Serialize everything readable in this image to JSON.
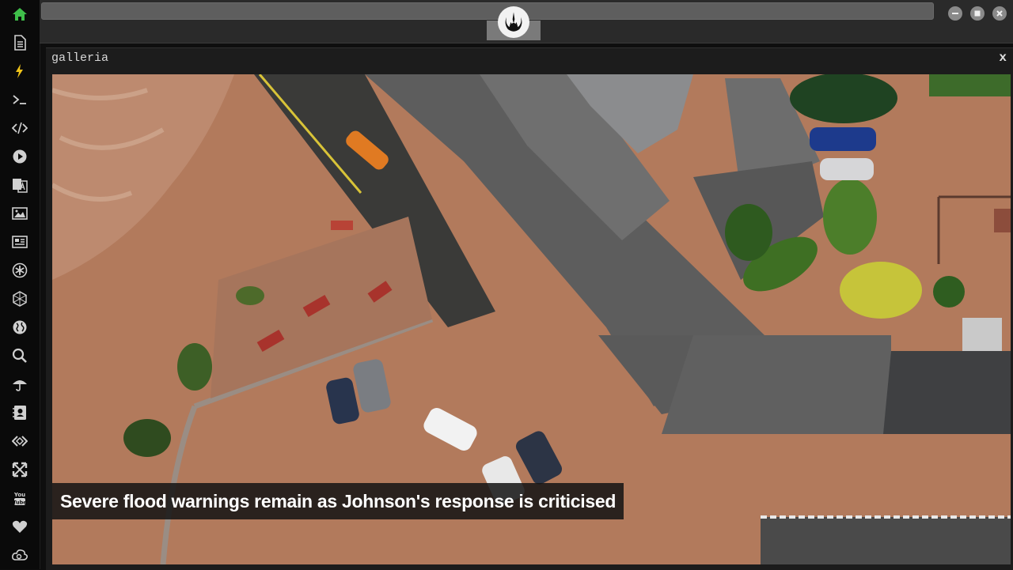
{
  "window": {
    "controls": {
      "minimize_icon": "minimize-icon",
      "maximize_icon": "maximize-icon",
      "close_icon": "close-icon"
    },
    "logo_icon": "rebel-alliance-icon"
  },
  "sidebar": {
    "items": [
      {
        "name": "home",
        "icon": "home-icon",
        "color": "#3fbf4a"
      },
      {
        "name": "document",
        "icon": "document-icon"
      },
      {
        "name": "lightning",
        "icon": "lightning-icon",
        "color": "#f0c419"
      },
      {
        "name": "terminal",
        "icon": "terminal-icon"
      },
      {
        "name": "code",
        "icon": "code-icon"
      },
      {
        "name": "play",
        "icon": "play-icon"
      },
      {
        "name": "translate",
        "icon": "translate-icon"
      },
      {
        "name": "image",
        "icon": "image-icon"
      },
      {
        "name": "news",
        "icon": "newspaper-icon"
      },
      {
        "name": "asterisk",
        "icon": "asterisk-icon"
      },
      {
        "name": "hexagon",
        "icon": "hexagon-icon"
      },
      {
        "name": "globe",
        "icon": "globe-icon"
      },
      {
        "name": "search",
        "icon": "search-icon"
      },
      {
        "name": "umbrella",
        "icon": "umbrella-icon"
      },
      {
        "name": "contact",
        "icon": "contact-card-icon"
      },
      {
        "name": "embed",
        "icon": "embed-code-icon"
      },
      {
        "name": "expand",
        "icon": "expand-icon"
      },
      {
        "name": "youtube",
        "icon": "youtube-icon"
      },
      {
        "name": "heart",
        "icon": "heart-icon"
      },
      {
        "name": "cloud",
        "icon": "cloud-icon"
      }
    ]
  },
  "panel": {
    "title": "galleria",
    "close_label": "x"
  },
  "gallery": {
    "caption": "Severe flood warnings remain as Johnson's response is criticised"
  },
  "colors": {
    "floodwater": "#b27a5c",
    "accent_home": "#3fbf4a",
    "accent_bolt": "#f0c419"
  }
}
